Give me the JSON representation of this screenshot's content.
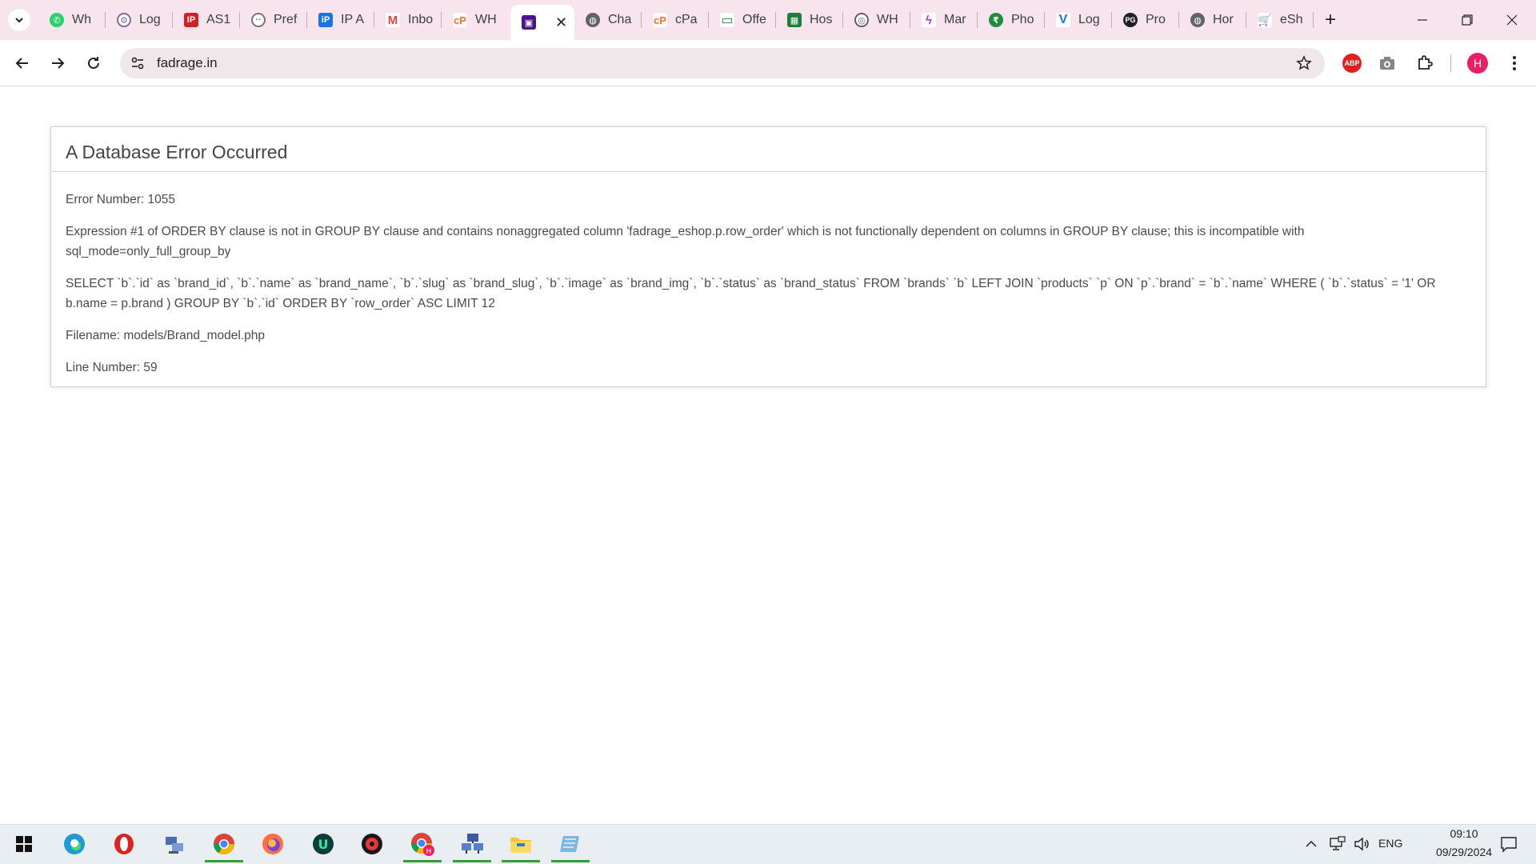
{
  "browser": {
    "tabs": [
      {
        "title": "Wh",
        "favicon": "whatsapp-icon",
        "color": "#25d366"
      },
      {
        "title": "Log",
        "favicon": "gear-globe-icon",
        "color": "#7a6fa0"
      },
      {
        "title": "AS1",
        "favicon": "ip-icon",
        "color": "#d32020"
      },
      {
        "title": "Pref",
        "favicon": "dots-icon",
        "color": "#666666"
      },
      {
        "title": "IP A",
        "favicon": "ip-a-icon",
        "color": "#1a73e8"
      },
      {
        "title": "Inbo",
        "favicon": "gmail-icon",
        "color": "#ea4335"
      },
      {
        "title": "WH",
        "favicon": "cpanel-icon",
        "color": "#ff6c2c"
      },
      {
        "title": "",
        "favicon": "store-icon",
        "color": "#6a1b9a",
        "active": true
      },
      {
        "title": "Cha",
        "favicon": "globe-icon",
        "color": "#5f6368"
      },
      {
        "title": "cPa",
        "favicon": "cpanel-icon",
        "color": "#ff6c2c"
      },
      {
        "title": "Offe",
        "favicon": "monitor-icon",
        "color": "#1e8e3e"
      },
      {
        "title": "Hos",
        "favicon": "sheets-icon",
        "color": "#188038"
      },
      {
        "title": "WH",
        "favicon": "wh-icon",
        "color": "#5f6368"
      },
      {
        "title": "Mar",
        "favicon": "kotlin-icon",
        "color": "#c026d3"
      },
      {
        "title": "Pho",
        "favicon": "phonepe-icon",
        "color": "#1e8e3e"
      },
      {
        "title": "Log",
        "favicon": "v-icon",
        "color": "#1a73e8"
      },
      {
        "title": "Pro",
        "favicon": "pg-icon",
        "color": "#202124"
      },
      {
        "title": "Hor",
        "favicon": "globe-icon",
        "color": "#5f6368"
      },
      {
        "title": "eSh",
        "favicon": "cart-icon",
        "color": "#f28b50"
      }
    ],
    "url": "fadrage.in"
  },
  "page": {
    "heading": "A Database Error Occurred",
    "error_number": "Error Number: 1055",
    "message": "Expression #1 of ORDER BY clause is not in GROUP BY clause and contains nonaggregated column 'fadrage_eshop.p.row_order' which is not functionally dependent on columns in GROUP BY clause; this is incompatible with sql_mode=only_full_group_by",
    "query": "SELECT `b`.`id` as `brand_id`, `b`.`name` as `brand_name`, `b`.`slug` as `brand_slug`, `b`.`image` as `brand_img`, `b`.`status` as `brand_status` FROM `brands` `b` LEFT JOIN `products` `p` ON `p`.`brand` = `b`.`name` WHERE ( `b`.`status` = '1' OR b.name = p.brand ) GROUP BY `b`.`id` ORDER BY `row_order` ASC LIMIT 12",
    "filename": "Filename: models/Brand_model.php",
    "line_number": "Line Number: 59"
  },
  "taskbar": {
    "apps": [
      "windows-start-icon",
      "edge-icon",
      "opera-icon",
      "network-app-icon",
      "chrome-icon",
      "firefox-icon",
      "u-app-icon",
      "red-app-icon",
      "chrome-profile-icon",
      "network-transfer-icon",
      "file-explorer-icon",
      "notepad-icon"
    ],
    "language": "ENG",
    "time": "09:10",
    "date": "09/29/2024"
  },
  "profile_initial": "H"
}
